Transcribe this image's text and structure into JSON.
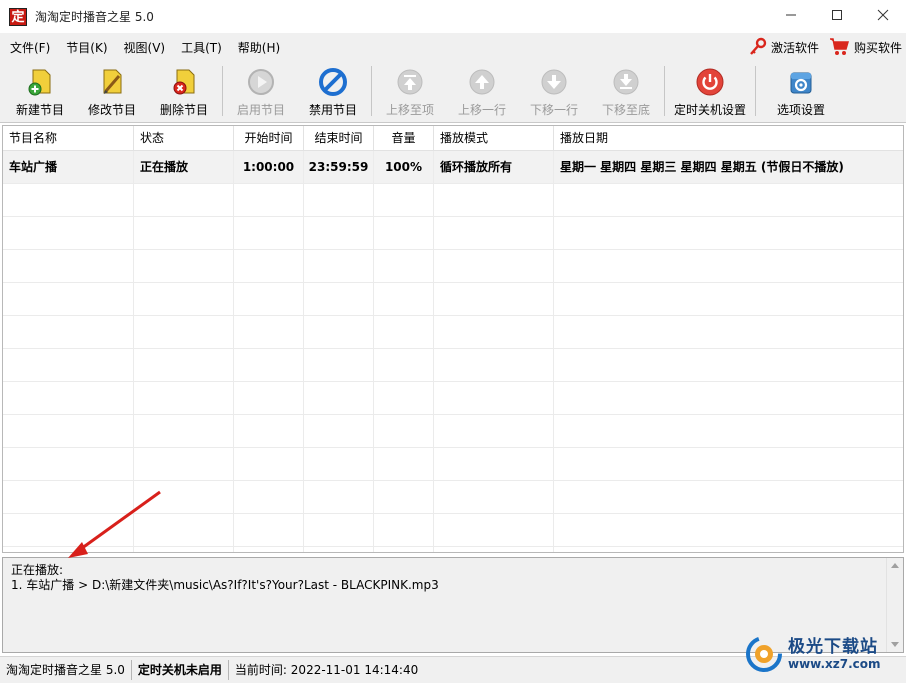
{
  "window": {
    "icon_char": "定",
    "title": "淘淘定时播音之星 5.0"
  },
  "menu": {
    "items": [
      "文件(F)",
      "节目(K)",
      "视图(V)",
      "工具(T)",
      "帮助(H)"
    ],
    "activate_label": "激活软件",
    "buy_label": "购买软件"
  },
  "toolbar": {
    "new_label": "新建节目",
    "edit_label": "修改节目",
    "delete_label": "删除节目",
    "enable_label": "启用节目",
    "disable_label": "禁用节目",
    "move_top_label": "上移至项",
    "move_up_label": "上移一行",
    "move_down_label": "下移一行",
    "move_bottom_label": "下移至底",
    "shutdown_label": "定时关机设置",
    "options_label": "选项设置"
  },
  "table": {
    "columns": [
      "节目名称",
      "状态",
      "开始时间",
      "结束时间",
      "音量",
      "播放模式",
      "播放日期"
    ],
    "rows": [
      {
        "name": "车站广播",
        "status": "正在播放",
        "start": "1:00:00",
        "end": "23:59:59",
        "volume": "100%",
        "mode": "循环播放所有",
        "date": "星期一 星期四 星期三 星期四 星期五 (节假日不播放)"
      }
    ]
  },
  "log": {
    "heading": "正在播放:",
    "line1": "1. 车站广播 > D:\\新建文件夹\\music\\As?If?It's?Your?Last - BLACKPINK.mp3"
  },
  "status": {
    "app": "淘淘定时播音之星 5.0",
    "shutdown_state": "定时关机未启用",
    "time_label": "当前时间:",
    "time_value": "2022-11-01 14:14:40"
  },
  "watermark": {
    "title": "极光下载站",
    "url": "www.xz7.com"
  },
  "colors": {
    "accent_red": "#d9261c",
    "disable_blue": "#1e6fd0",
    "power_red": "#e2443a",
    "annotation_red": "#d8201b"
  }
}
